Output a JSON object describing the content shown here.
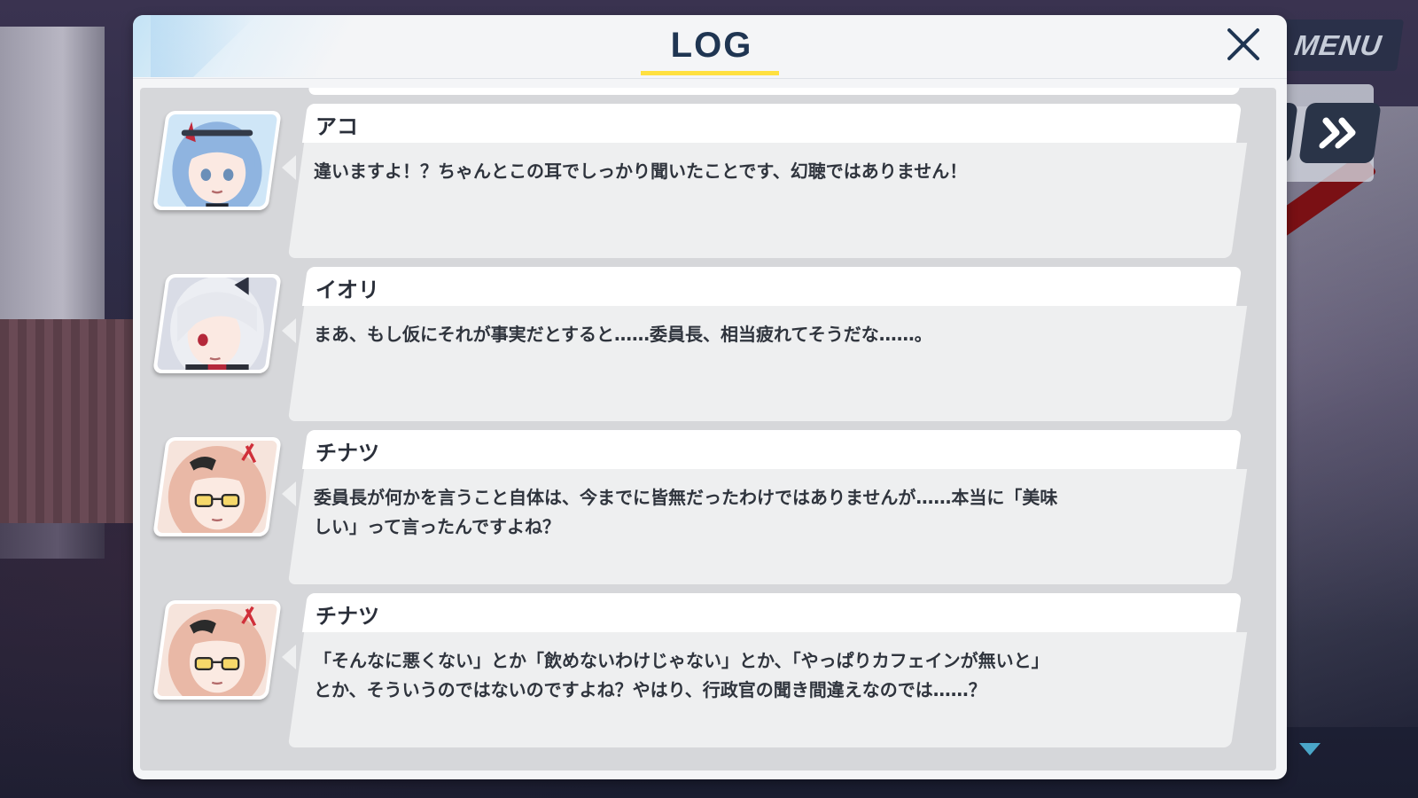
{
  "header": {
    "title": "LOG"
  },
  "menu": {
    "label": "MENU"
  },
  "entries": [
    {
      "speaker": "アコ",
      "text": "違いますよ！？ちゃんとこの耳でしっかり聞いたことです、幻聴ではありません！",
      "portrait": "ako-portrait",
      "hair_color": "#8fb4e0",
      "bg_color": "#cfe6f7"
    },
    {
      "speaker": "イオリ",
      "text": "まあ、もし仮にそれが事実だとすると……委員長、相当疲れてそうだな……。",
      "portrait": "iori-portrait",
      "hair_color": "#e6e8ee",
      "bg_color": "#d9dce6"
    },
    {
      "speaker": "チナツ",
      "text": "委員長が何かを言うこと自体は、今までに皆無だったわけではありませんが……本当に「美味\nしい」って言ったんですよね？",
      "portrait": "chinatsu-portrait",
      "hair_color": "#e9b8a6",
      "bg_color": "#f6e4dc"
    },
    {
      "speaker": "チナツ",
      "text": "「そんなに悪くない」とか「飲めないわけじゃない」とか、「やっぱりカフェインが無いと」\nとか、そういうのではないのですよね？やはり、行政官の聞き間違えなのでは……？",
      "portrait": "chinatsu-portrait",
      "hair_color": "#e9b8a6",
      "bg_color": "#f6e4dc"
    }
  ],
  "colors": {
    "title": "#1f3552",
    "underline": "#ffe040",
    "bubble_top": "#ffffff",
    "bubble_body": "#eeeff0",
    "list_bg": "#d6d7da"
  },
  "icons": {
    "close": "close-icon",
    "skip": "fast-forward-icon",
    "scroll_down": "scroll-down-icon"
  }
}
